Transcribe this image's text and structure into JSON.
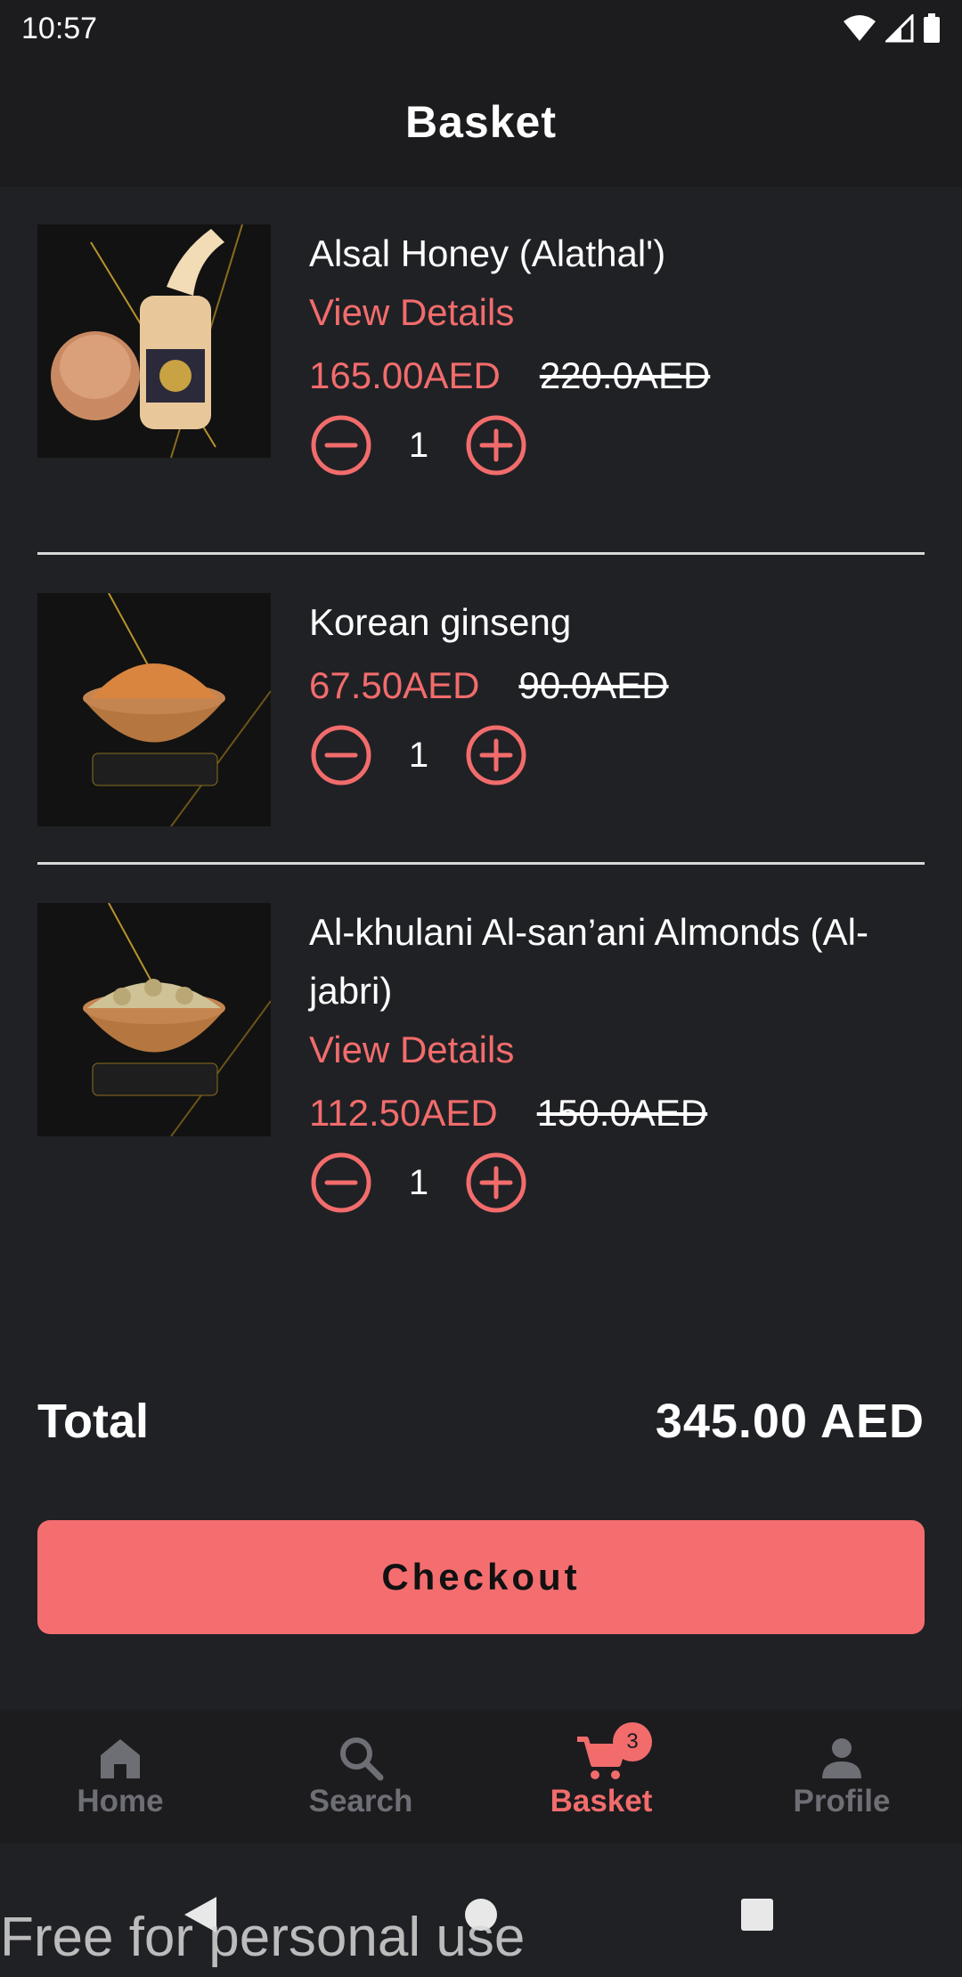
{
  "status_bar": {
    "time": "10:57"
  },
  "app_bar": {
    "title": "Basket"
  },
  "items": [
    {
      "name": "Alsal Honey (Alathal')",
      "view_details": "View Details",
      "price": "165.00AED",
      "old_price": "220.0AED",
      "quantity": "1"
    },
    {
      "name": "Korean ginseng",
      "price": "67.50AED",
      "old_price": "90.0AED",
      "quantity": "1"
    },
    {
      "name": "Al-khulani Al-san’ani Almonds (Al-jabri)",
      "view_details": "View Details",
      "price": "112.50AED",
      "old_price": "150.0AED",
      "quantity": "1"
    }
  ],
  "total": {
    "label": "Total",
    "value": "345.00 AED"
  },
  "checkout_label": "Checkout",
  "bottom_nav": {
    "items": [
      {
        "label": "Home",
        "icon": "home-icon"
      },
      {
        "label": "Search",
        "icon": "search-icon"
      },
      {
        "label": "Basket",
        "icon": "cart-icon",
        "badge": "3",
        "active": true
      },
      {
        "label": "Profile",
        "icon": "person-icon"
      }
    ]
  },
  "watermark": "Free for personal use",
  "colors": {
    "accent": "#f26c6c",
    "background": "#202125",
    "bar": "#1c1c1f",
    "button": "#f46e70"
  }
}
